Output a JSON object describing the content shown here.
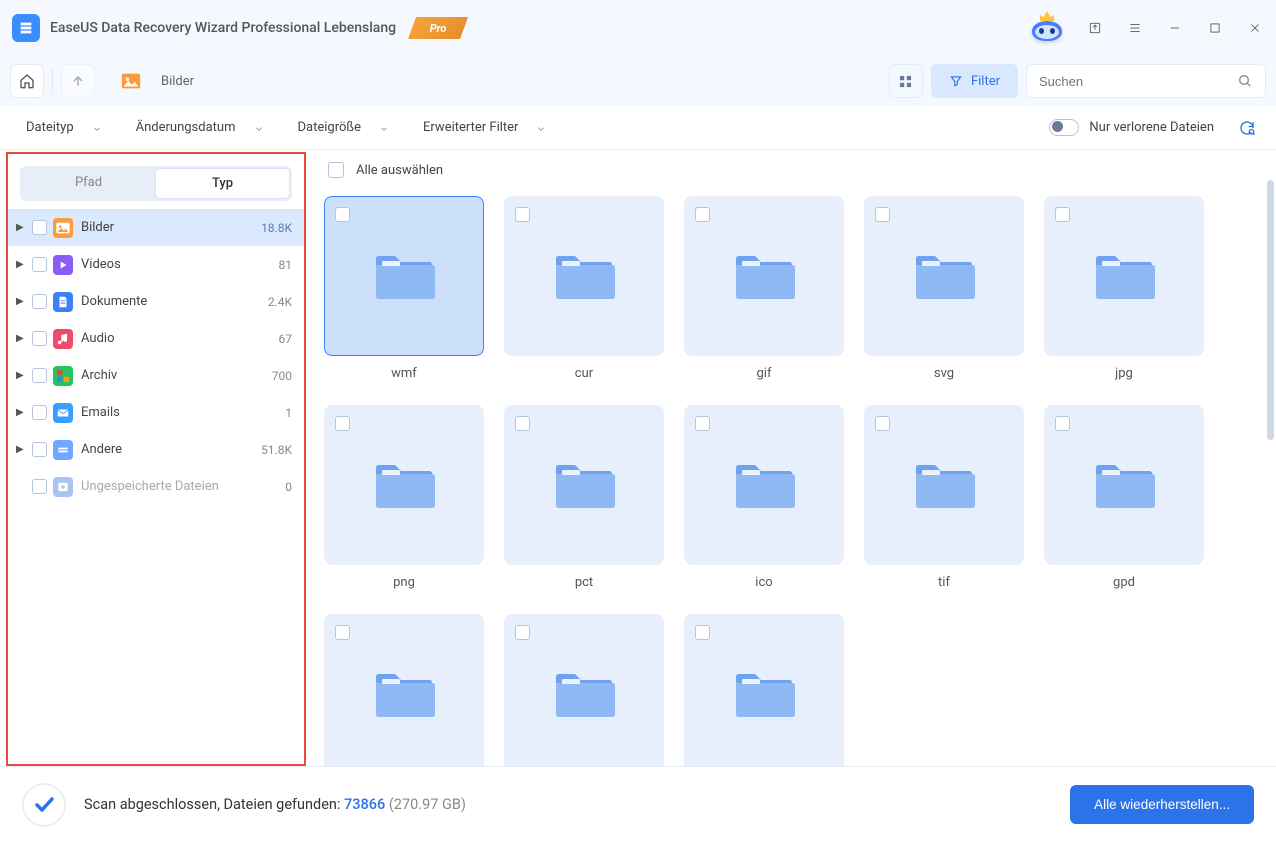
{
  "app": {
    "title": "EaseUS Data Recovery Wizard Professional Lebenslang",
    "pro_badge": "Pro"
  },
  "toolbar": {
    "breadcrumb_label": "Bilder",
    "filter_label": "Filter",
    "search_placeholder": "Suchen"
  },
  "filterbar": {
    "filetype": "Dateityp",
    "moddate": "Änderungsdatum",
    "filesize": "Dateigröße",
    "advanced": "Erweiterter Filter",
    "lost_only": "Nur verlorene Dateien"
  },
  "sidebar": {
    "tab_path": "Pfad",
    "tab_type": "Typ",
    "items": [
      {
        "label": "Bilder",
        "count": "18.8K",
        "color": "#ff9a3c",
        "selected": true
      },
      {
        "label": "Videos",
        "count": "81",
        "color": "#8b5cf6"
      },
      {
        "label": "Dokumente",
        "count": "2.4K",
        "color": "#3b82f6"
      },
      {
        "label": "Audio",
        "count": "67",
        "color": "#ef4b6e"
      },
      {
        "label": "Archiv",
        "count": "700",
        "color": "#22c55e"
      },
      {
        "label": "Emails",
        "count": "1",
        "color": "#3b9eff"
      },
      {
        "label": "Andere",
        "count": "51.8K",
        "color": "#6ea8ff"
      },
      {
        "label": "Ungespeicherte Dateien",
        "count": "0",
        "color": "#a8c5ef",
        "dim": true,
        "no_arrow": true
      }
    ]
  },
  "content": {
    "select_all": "Alle auswählen",
    "folders": [
      {
        "name": "wmf",
        "selected": true
      },
      {
        "name": "cur"
      },
      {
        "name": "gif"
      },
      {
        "name": "svg"
      },
      {
        "name": "jpg"
      },
      {
        "name": "png"
      },
      {
        "name": "pct"
      },
      {
        "name": "ico"
      },
      {
        "name": "tif"
      },
      {
        "name": "gpd"
      },
      {
        "name": ""
      },
      {
        "name": ""
      },
      {
        "name": ""
      }
    ]
  },
  "status": {
    "prefix": "Scan abgeschlossen, Dateien gefunden: ",
    "count": "73866",
    "size": " (270.97 GB)",
    "recover_btn": "Alle wiederherstellen..."
  }
}
